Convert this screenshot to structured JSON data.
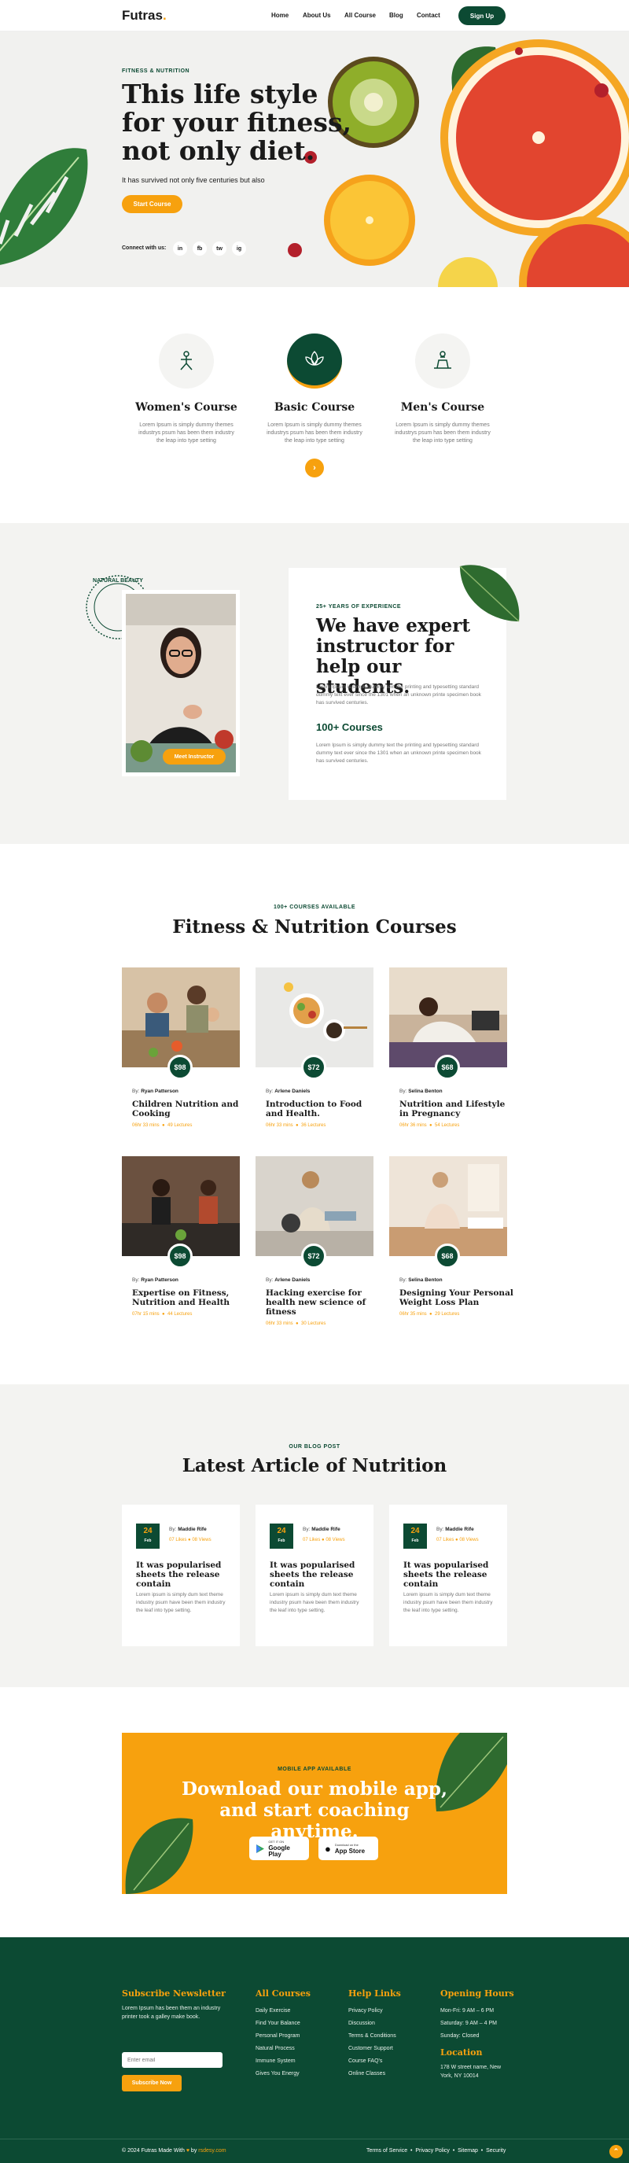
{
  "header": {
    "logo": "Futras",
    "logo_dot": ".",
    "nav": [
      "Home",
      "About Us",
      "All Course",
      "Blog",
      "Contact"
    ],
    "signup": "Sign Up"
  },
  "hero": {
    "kicker": "FITNESS & NUTRITION",
    "title": "This life style for your fitness, not only diet.",
    "subtitle": "It has survived not only five centuries but also",
    "button": "Start Course",
    "connect": "Connect with us:",
    "socials": [
      "in",
      "fb",
      "tw",
      "ig"
    ]
  },
  "course_types": {
    "items": [
      {
        "title": "Women's Course",
        "desc": "Lorem Ipsum is simply dummy themes industrys psum has been them industry the leap into type setting"
      },
      {
        "title": "Basic Course",
        "desc": "Lorem Ipsum is simply dummy themes industrys psum has been them industry the leap into type setting"
      },
      {
        "title": "Men's Course",
        "desc": "Lorem Ipsum is simply dummy themes industrys psum has been them industry the leap into type setting"
      }
    ]
  },
  "instructor": {
    "badge_text": "NATURAL BEAUTY",
    "button": "Meet Instructor",
    "kicker": "25+ YEARS OF EXPERIENCE",
    "title": "We have expert instructor for help our students.",
    "para1": "Lorem Ipsum is simply dummy text the printing and typesetting standard dummy text ever since the 1301 when an unknown printe specimen book has survived centuries.",
    "courses_title": "100+ Courses",
    "para2": "Lorem Ipsum is simply dummy text the printing and typesetting standard dummy text ever since the 1301 when an unknown printe specimen book has survived centuries."
  },
  "courses": {
    "kicker": "100+ COURSES AVAILABLE",
    "title": "Fitness & Nutrition Courses",
    "items": [
      {
        "price": "$98",
        "by": "By:",
        "author": "Ryan Patterson",
        "title": "Children Nutrition and Cooking",
        "time": "06hr 33 mins",
        "lectures": "49 Lectures"
      },
      {
        "price": "$72",
        "by": "By:",
        "author": "Arlene Daniels",
        "title": "Introduction to Food and Health.",
        "time": "06hr 33 mins",
        "lectures": "36 Lectures"
      },
      {
        "price": "$68",
        "by": "By:",
        "author": "Selina Benton",
        "title": "Nutrition and Lifestyle in Pregnancy",
        "time": "06hr 36 mins",
        "lectures": "54 Lectures"
      },
      {
        "price": "$98",
        "by": "By:",
        "author": "Ryan Patterson",
        "title": "Expertise on Fitness, Nutrition and Health",
        "time": "07hr 15 mins",
        "lectures": "44 Lectures"
      },
      {
        "price": "$72",
        "by": "By:",
        "author": "Arlene Daniels",
        "title": "Hacking exercise for health new science of fitness",
        "time": "06hr 33 mins",
        "lectures": "30 Lectures"
      },
      {
        "price": "$68",
        "by": "By:",
        "author": "Selina Benton",
        "title": "Designing Your Personal Weight Loss Plan",
        "time": "06hr 35 mins",
        "lectures": "29 Lectures"
      }
    ]
  },
  "blog": {
    "kicker": "OUR BLOG POST",
    "title": "Latest Article of Nutrition",
    "items": [
      {
        "day": "24",
        "month": "Feb",
        "by": "By:",
        "author": "Maddie Rife",
        "views": "07 Likes",
        "comments": "08 Views",
        "title": "It was popularised sheets the release contain",
        "desc": "Lorem ipsum is simply dum text theme industry psum have been them industry the leaf into type setting."
      },
      {
        "day": "24",
        "month": "Feb",
        "by": "By:",
        "author": "Maddie Rife",
        "views": "07 Likes",
        "comments": "08 Views",
        "title": "It was popularised sheets the release contain",
        "desc": "Lorem ipsum is simply dum text theme industry psum have been them industry the leaf into type setting."
      },
      {
        "day": "24",
        "month": "Feb",
        "by": "By:",
        "author": "Maddie Rife",
        "views": "07 Likes",
        "comments": "08 Views",
        "title": "It was popularised sheets the release contain",
        "desc": "Lorem ipsum is simply dum text theme industry psum have been them industry the leaf into type setting."
      }
    ]
  },
  "app": {
    "kicker": "MOBILE APP AVAILABLE",
    "title": "Download our mobile app, and start coaching anytime.",
    "google_small": "GET IT ON",
    "google": "Google Play",
    "apple_small": "Download on the",
    "apple": "App Store"
  },
  "footer": {
    "newsletter_title": "Subscribe Newsletter",
    "newsletter_text": "Lorem Ipsum has been them an industry printer took a galley make book.",
    "email_placeholder": "Enter email",
    "subscribe": "Subscribe Now",
    "courses_title": "All Courses",
    "courses": [
      "Daily Exercise",
      "Find Your Balance",
      "Personal Program",
      "Natural Process",
      "Immune System",
      "Gives You Energy"
    ],
    "help_title": "Help Links",
    "help": [
      "Privacy Policy",
      "Discussion",
      "Terms & Conditions",
      "Customer Support",
      "Course FAQ's",
      "Online Classes"
    ],
    "hours_title": "Opening Hours",
    "hours": [
      "Mon-Fri: 9 AM – 6 PM",
      "Saturday: 9 AM – 4 PM",
      "Sunday: Closed"
    ],
    "location_title": "Location",
    "location": "178 W street name, New York, NY 10014",
    "copyright": "© 2024 Futras Made With",
    "copyright_by": "by",
    "copyright_brand": "rsdesy.com",
    "bottom_links": [
      "Terms of Service",
      "Privacy Policy",
      "Sitemap",
      "Security"
    ]
  }
}
